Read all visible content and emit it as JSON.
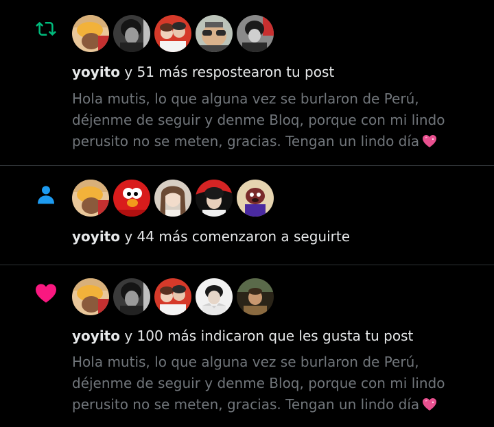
{
  "colors": {
    "background": "#000000",
    "primary_text": "#e7e9ea",
    "secondary_text": "#71767b",
    "divider": "#2f3336",
    "repost_green": "#00ba7c",
    "follow_blue": "#1d9bf0",
    "like_pink": "#f91880"
  },
  "notifications": [
    {
      "type_icon": "repost-icon",
      "user": "yoyito",
      "action_text": " y 51 más respostearon tu post",
      "preview_lines": [
        "Hola mutis, lo que alguna vez se burlaron de Perú,",
        "déjenme de seguir y denme Bloq, porque con mi lindo",
        "perusito no se meten, gracias. Tengan un lindo día"
      ],
      "preview_emoji": "sparkling-heart-emoji"
    },
    {
      "type_icon": "person-icon",
      "user": "yoyito",
      "action_text": " y 44 más comenzaron a seguirte"
    },
    {
      "type_icon": "heart-icon",
      "user": "yoyito",
      "action_text": " y 100 más indicaron que les gusta tu post",
      "preview_lines": [
        "Hola mutis, lo que alguna vez se burlaron de Perú,",
        "déjenme de seguir y denme Bloq, porque con mi lindo",
        "perusito no se meten, gracias. Tengan un lindo día"
      ],
      "preview_emoji": "sparkling-heart-emoji"
    }
  ]
}
